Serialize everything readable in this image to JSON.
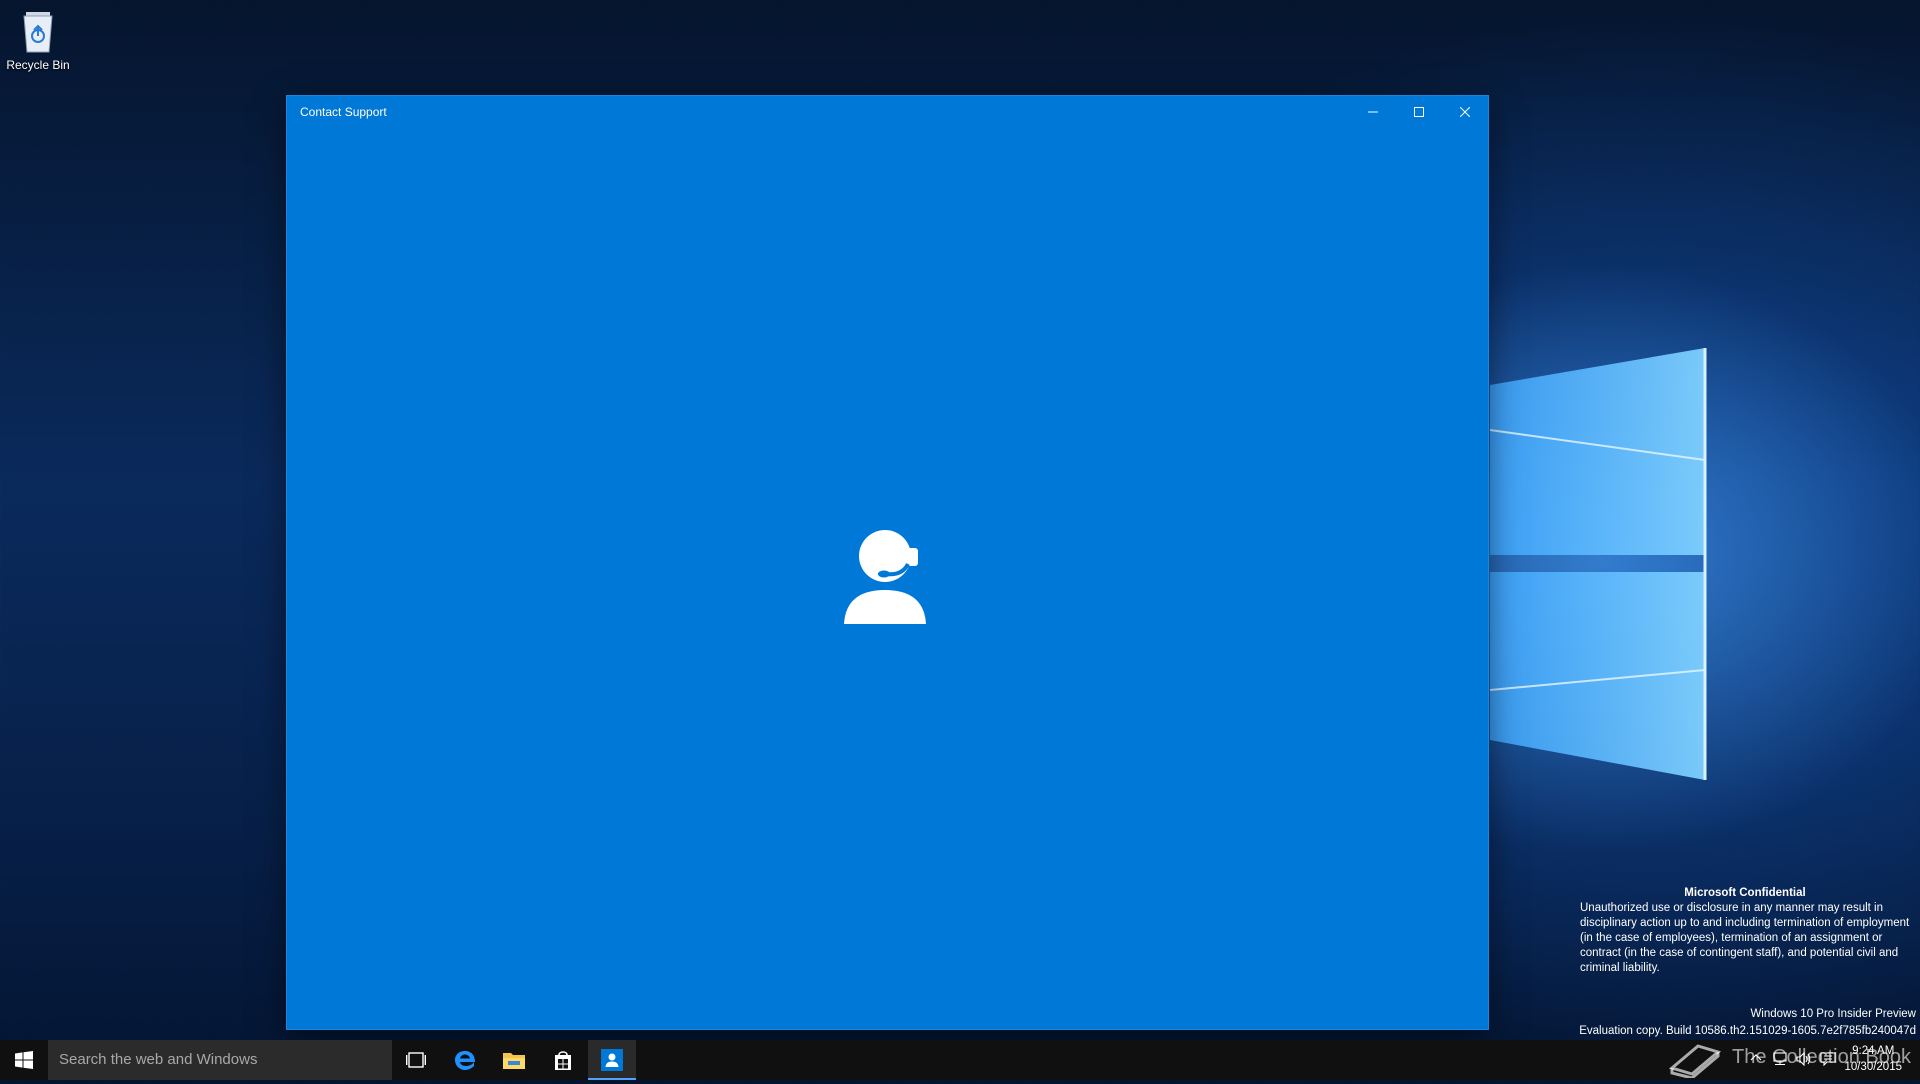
{
  "desktop": {
    "icons": [
      {
        "label": "Recycle Bin",
        "icon": "recycle-bin-icon"
      }
    ]
  },
  "window": {
    "title": "Contact Support",
    "controls": [
      "minimize",
      "maximize",
      "close"
    ],
    "background": "#0078d7",
    "center_icon": "support-agent-icon"
  },
  "confidential": {
    "heading": "Microsoft Confidential",
    "body": "Unauthorized use or disclosure in any manner may result in disciplinary action up to and including termination of employment (in the case of employees), termination of an assignment or contract (in the case of contingent staff), and potential civil and criminal liability."
  },
  "edition": {
    "line1": "Windows 10 Pro Insider Preview",
    "line2": "Evaluation copy. Build 10586.th2.151029-1605.7e2f785fb240047d"
  },
  "taskbar": {
    "search_placeholder": "Search the web and Windows",
    "apps": [
      "task-view-icon",
      "edge-icon",
      "file-explorer-icon",
      "store-icon",
      "contact-support-icon"
    ],
    "active_app": "contact-support-icon"
  },
  "tray": {
    "time": "9:24 AM",
    "date": "10/30/2015",
    "icons": [
      "chevron-up-icon",
      "network-icon",
      "volume-icon",
      "action-center-icon"
    ]
  },
  "watermark": {
    "text": "The Collection Book"
  }
}
